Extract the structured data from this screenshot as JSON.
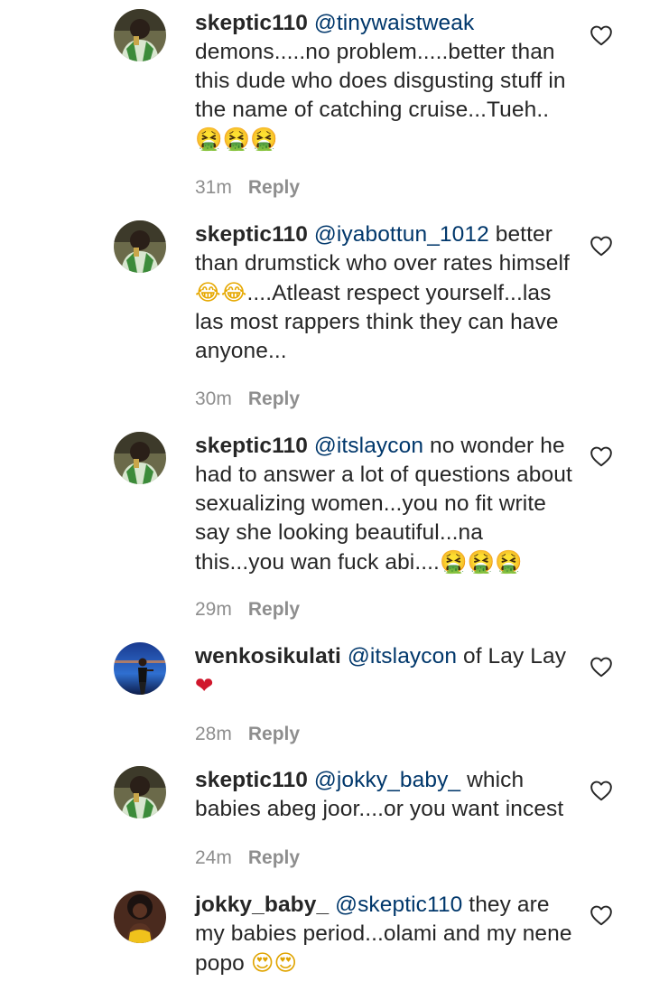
{
  "comments": [
    {
      "username": "skeptic110",
      "mention": "@tinywaistweak",
      "text": " demons.....no problem.....better than this dude who does disgusting stuff in the name of catching cruise...Tueh..",
      "emoji": "🤮🤮🤮",
      "time": "31m",
      "reply_label": "Reply",
      "avatar_icon": "profile-photo-man-green-shirt"
    },
    {
      "username": "skeptic110",
      "mention": "@iyabottun_1012",
      "text": " better than drumstick who over rates himself ",
      "emoji": "😂😂",
      "text_after": "....Atleast respect yourself...las las most rappers think they can have anyone...",
      "time": "30m",
      "reply_label": "Reply",
      "avatar_icon": "profile-photo-man-green-shirt"
    },
    {
      "username": "skeptic110",
      "mention": "@itslaycon",
      "text": " no wonder he had to answer a lot of questions about sexualizing women...you no fit write say she looking beautiful...na this...you wan fuck abi....",
      "emoji": "🤮🤮🤮",
      "time": "29m",
      "reply_label": "Reply",
      "avatar_icon": "profile-photo-man-green-shirt"
    },
    {
      "username": "wenkosikulati",
      "mention": "@itslaycon",
      "text": " of Lay Lay ",
      "emoji": "❤",
      "time": "28m",
      "reply_label": "Reply",
      "avatar_icon": "profile-photo-woman-blue-background"
    },
    {
      "username": "skeptic110",
      "mention": "@jokky_baby_",
      "text": " which babies abeg joor....or you want incest",
      "emoji": "",
      "time": "24m",
      "reply_label": "Reply",
      "avatar_icon": "profile-photo-man-green-shirt"
    },
    {
      "username": "jokky_baby_",
      "mention": "@skeptic110",
      "text": " they are my babies period...olami and my nene popo ",
      "emoji": "😍😍",
      "time": "",
      "reply_label": "",
      "avatar_icon": "profile-photo-woman-yellow-top"
    }
  ],
  "colors": {
    "mention": "#00376b",
    "text": "#262626",
    "meta": "#8e8e8e"
  }
}
